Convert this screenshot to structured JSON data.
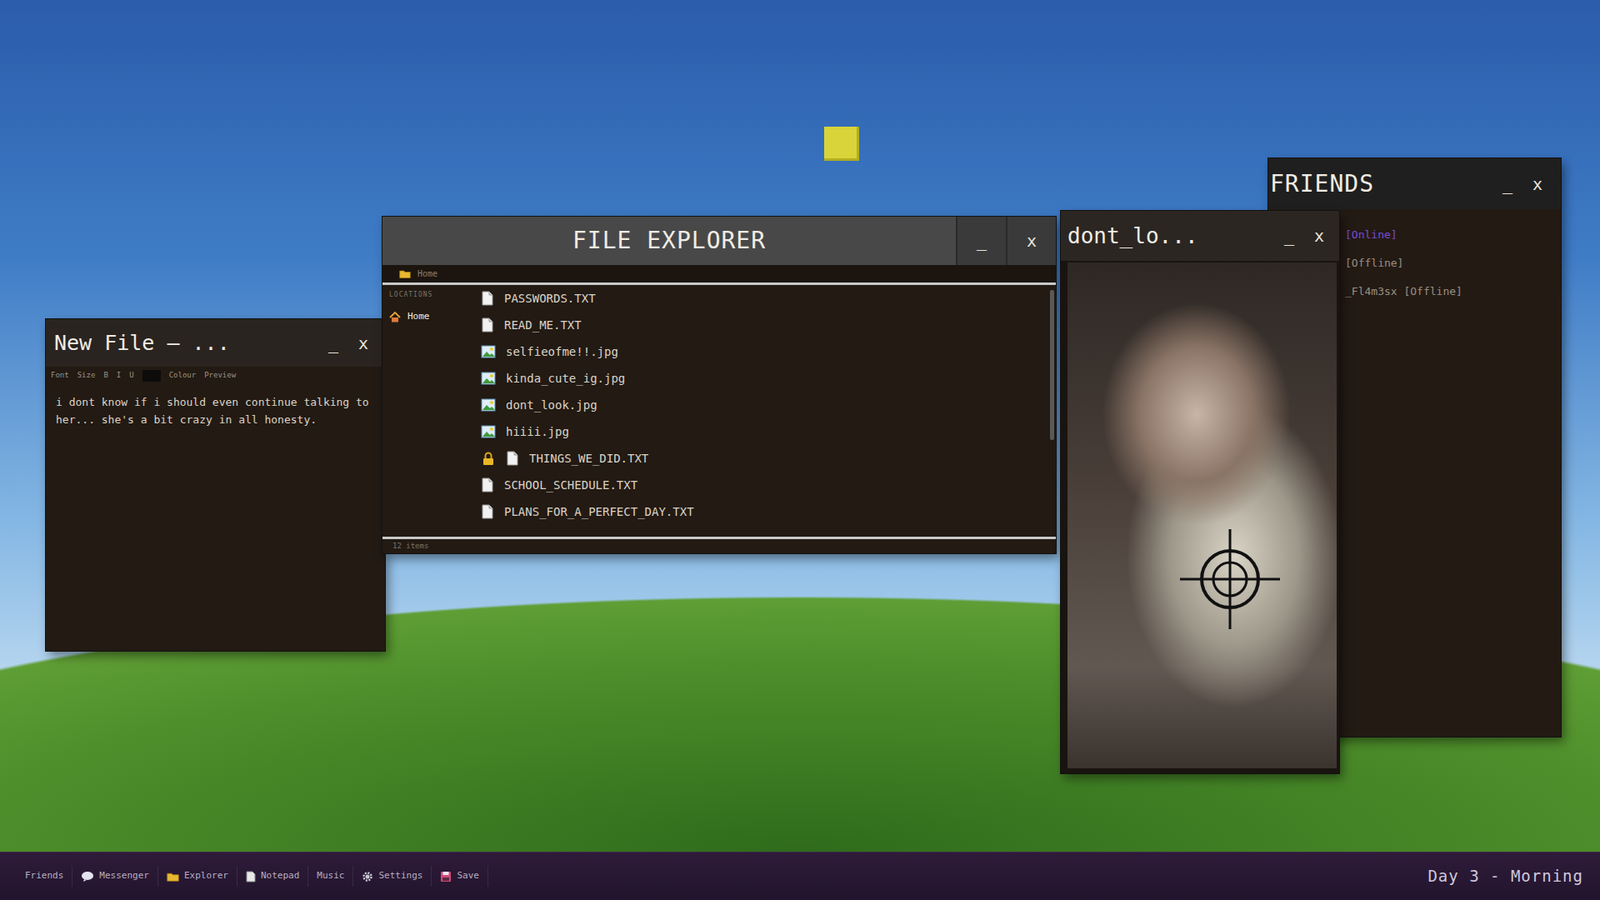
{
  "notepad": {
    "title": "New File — ...",
    "minimize": "_",
    "close": "x",
    "toolbar": [
      "Font",
      "Size",
      "B",
      "I",
      "U",
      "Colour",
      "Preview"
    ],
    "text": "i dont know if i should even continue talking to her... she's a bit crazy in all honesty."
  },
  "explorer": {
    "title": "FILE EXPLORER",
    "minimize": "_",
    "close": "x",
    "path": "Home",
    "sidebar": {
      "heading": "LOCATIONS",
      "items": [
        {
          "label": "Home",
          "selected": true
        }
      ]
    },
    "files": [
      {
        "name": "PASSWORDS.TXT",
        "kind": "text",
        "locked": false
      },
      {
        "name": "READ_ME.TXT",
        "kind": "text",
        "locked": false
      },
      {
        "name": "selfieofme!!.jpg",
        "kind": "image",
        "locked": false
      },
      {
        "name": "kinda_cute_ig.jpg",
        "kind": "image",
        "locked": false
      },
      {
        "name": "dont_look.jpg",
        "kind": "image",
        "locked": false
      },
      {
        "name": "hiiii.jpg",
        "kind": "image",
        "locked": false
      },
      {
        "name": "THINGS_WE_DID.TXT",
        "kind": "text",
        "locked": true
      },
      {
        "name": "SCHOOL_SCHEDULE.TXT",
        "kind": "text",
        "locked": false
      },
      {
        "name": "PLANS_FOR_A_PERFECT_DAY.TXT",
        "kind": "text",
        "locked": false
      }
    ],
    "count": "12 items"
  },
  "viewer": {
    "title": "dont_lo...",
    "minimize": "_",
    "close": "x"
  },
  "friends": {
    "title": "FRIENDS",
    "minimize": "_",
    "close": "x",
    "items": [
      {
        "label": "[Online]",
        "color": "#7a4bd6"
      },
      {
        "label": "[Offline]",
        "color": "#9a8f80"
      },
      {
        "label": "_Fl4m3sx [Offline]",
        "color": "#9a8f80"
      }
    ]
  },
  "taskbar": {
    "items": [
      "Friends",
      "Messenger",
      "Explorer",
      "Notepad",
      "Music",
      "Settings",
      "Save"
    ],
    "clock": "Day 3 - Morning"
  }
}
